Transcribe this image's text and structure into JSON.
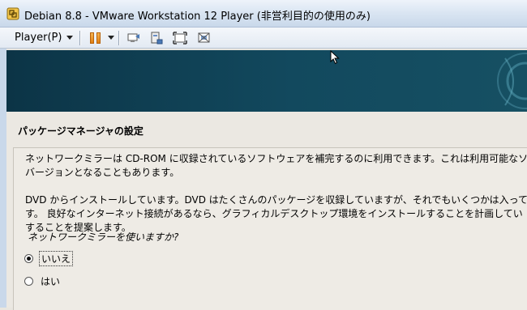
{
  "window": {
    "title": "Debian 8.8 - VMware Workstation 12 Player (非営利目的の使用のみ)"
  },
  "toolbar": {
    "player_menu_label": "Player(P)"
  },
  "installer": {
    "section_title": "パッケージマネージャの設定",
    "paragraphs": [
      "ネットワークミラーは CD-ROM に収録されているソフトウェアを補完するのに利用できます。これは利用可能なソフ",
      "バージョンとなることもあります。",
      "DVD からインストールしています。DVD はたくさんのパッケージを収録していますが、それでもいくつかは入ってい",
      "す。 良好なインターネット接続があるなら、グラフィカルデスクトップ環境をインストールすることを計画してい",
      "することを提案します。"
    ],
    "question": "ネットワークミラーを使いますか?",
    "options": [
      {
        "label": "いいえ",
        "selected": true
      },
      {
        "label": "はい",
        "selected": false
      }
    ]
  },
  "colors": {
    "banner": "#12495e",
    "content_bg": "#ebe8e2",
    "pause_accent": "#e8901a"
  }
}
